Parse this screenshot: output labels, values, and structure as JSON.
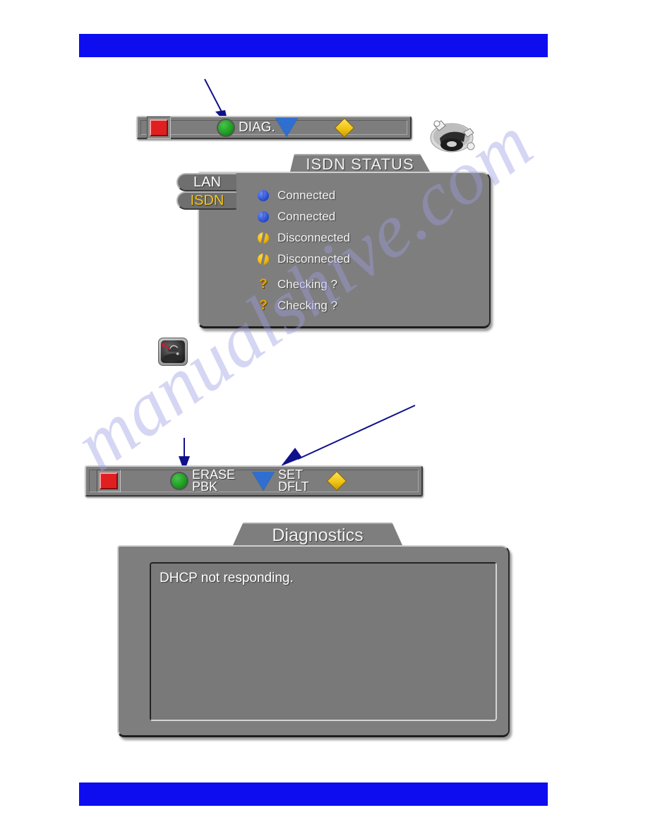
{
  "page": {
    "bar_color": "#0d0df0",
    "watermark": "manualshive.com"
  },
  "toolbar_diag": {
    "keys": [
      {
        "glyph": "red-square",
        "label": ""
      },
      {
        "glyph": "green-circle",
        "label": "DIAG."
      },
      {
        "glyph": "blue-triangle",
        "label": ""
      },
      {
        "glyph": "yellow-diamond",
        "label": ""
      }
    ]
  },
  "toolbar_erase": {
    "keys": [
      {
        "glyph": "red-square",
        "label": ""
      },
      {
        "glyph": "green-circle",
        "label": "ERASE\nPBK"
      },
      {
        "glyph": "blue-triangle",
        "label": "SET\nDFLT"
      },
      {
        "glyph": "yellow-diamond",
        "label": ""
      }
    ]
  },
  "isdn_panel": {
    "title": "ISDN  STATUS",
    "tabs": [
      {
        "label": "LAN",
        "selected": false
      },
      {
        "label": "ISDN",
        "selected": true
      }
    ],
    "rows": [
      {
        "icon": "connected-icon",
        "text": "Connected"
      },
      {
        "icon": "connected-icon",
        "text": "Connected"
      },
      {
        "icon": "disconnected-icon",
        "text": "Disconnected"
      },
      {
        "icon": "disconnected-icon",
        "text": "Disconnected"
      },
      {
        "icon": "checking-icon",
        "text": "Checking ?"
      },
      {
        "icon": "checking-icon",
        "text": "Checking ?"
      }
    ]
  },
  "diagnostics_panel": {
    "title": "Diagnostics",
    "message": "DHCP not responding."
  },
  "icons": {
    "tools": "tools-icon",
    "phone": "phone-diagnostics-icon"
  },
  "colors": {
    "bar_blue": "#0d0df0",
    "panel_gray": "#7e7e7e",
    "key_red": "#e02020",
    "key_green": "#1d9e22",
    "key_blue": "#2f6fd0",
    "key_yellow": "#f0c416",
    "tab_selected_text": "#f5c518",
    "arrow_navy": "#10108c"
  }
}
